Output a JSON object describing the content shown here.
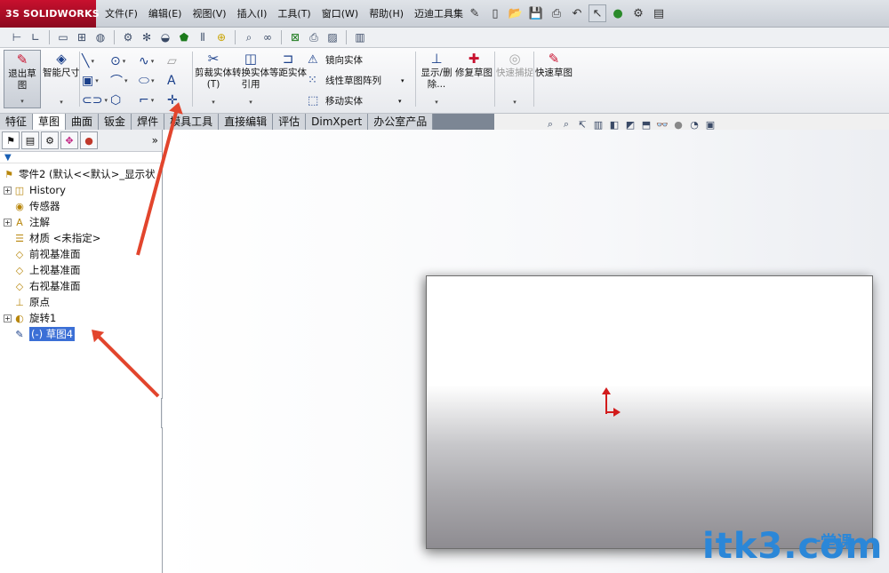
{
  "app": {
    "logo": "SOLIDWORKS",
    "logo_mark": "3S"
  },
  "menu": [
    "文件(F)",
    "编辑(E)",
    "视图(V)",
    "插入(I)",
    "工具(T)",
    "窗口(W)",
    "帮助(H)",
    "迈迪工具集"
  ],
  "ribbon": {
    "exit_sketch": "退出草图",
    "smart_dim": "智能尺寸",
    "trim": "剪裁实体(T)",
    "convert": "转换实体引用",
    "offset": "等距实体",
    "mirror": "镜向实体",
    "linear_pattern": "线性草图阵列",
    "move": "移动实体",
    "show_delete": "显示/删除...",
    "repair": "修复草图",
    "quick_snap": "快速捕捉",
    "quick_sketch": "快速草图"
  },
  "tabs": [
    "特征",
    "草图",
    "曲面",
    "钣金",
    "焊件",
    "模具工具",
    "直接编辑",
    "评估",
    "DimXpert",
    "办公室产品"
  ],
  "active_tab": "草图",
  "tree": {
    "part": "零件2 (默认<<默认>_显示状",
    "items": [
      {
        "label": "History",
        "expand": "+",
        "icon": "history-icon"
      },
      {
        "label": "传感器",
        "expand": "",
        "icon": "sensor-icon"
      },
      {
        "label": "注解",
        "expand": "+",
        "icon": "annotation-icon"
      },
      {
        "label": "材质 <未指定>",
        "expand": "",
        "icon": "material-icon"
      },
      {
        "label": "前视基准面",
        "expand": "",
        "icon": "plane-icon"
      },
      {
        "label": "上视基准面",
        "expand": "",
        "icon": "plane-icon"
      },
      {
        "label": "右视基准面",
        "expand": "",
        "icon": "plane-icon"
      },
      {
        "label": "原点",
        "expand": "",
        "icon": "origin-icon"
      },
      {
        "label": "旋转1",
        "expand": "+",
        "icon": "revolve-icon"
      },
      {
        "label": "(-) 草图4",
        "expand": "",
        "icon": "sketch-icon",
        "selected": true
      }
    ]
  },
  "watermark": {
    "main": "itk3",
    "dot": ".com",
    "cn": "一堂课"
  }
}
